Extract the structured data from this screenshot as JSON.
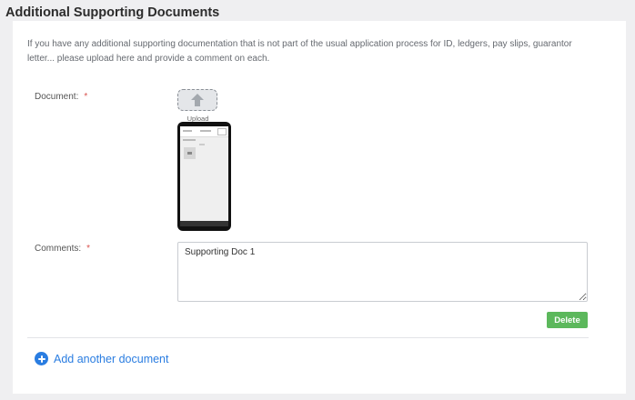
{
  "section": {
    "title": "Additional Supporting Documents"
  },
  "intro": {
    "text": "If you have any additional supporting documentation that is not part of the usual application process for ID, ledgers, pay slips, guarantor letter... please upload here and provide a comment on each."
  },
  "document": {
    "label": "Document:",
    "required_mark": "*",
    "upload_label": "Upload",
    "upload_icon": "arrow-up-icon"
  },
  "comments": {
    "label": "Comments:",
    "required_mark": "*",
    "value": "Supporting Doc 1"
  },
  "actions": {
    "delete_label": "Delete",
    "add_label": "Add another document",
    "add_icon": "plus-circle-icon"
  },
  "colors": {
    "required": "#d9534f",
    "delete": "#5cb85c",
    "link": "#2a7de1"
  }
}
